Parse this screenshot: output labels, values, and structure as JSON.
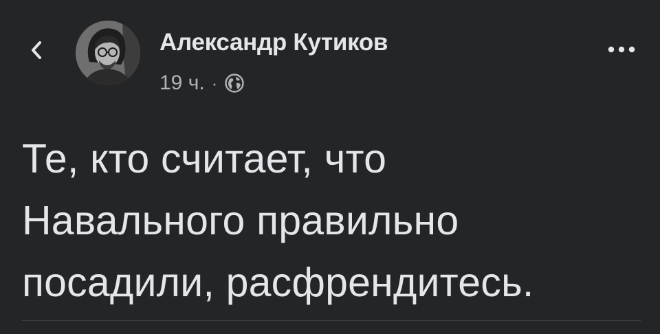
{
  "post": {
    "author_name": "Александр Кутиков",
    "time": "19 ч.",
    "separator": "·",
    "audience_icon": "globe-icon",
    "text_lines": [
      "Те, кто считает, что",
      "Навального правильно",
      "посадили, расфрендитесь."
    ]
  },
  "header": {
    "back_icon": "chevron-left-icon",
    "more_icon": "more-horizontal-icon"
  },
  "colors": {
    "background": "#242526",
    "primary_text": "#e4e6eb",
    "secondary_text": "#b0b3b8",
    "divider": "#3e4042"
  }
}
